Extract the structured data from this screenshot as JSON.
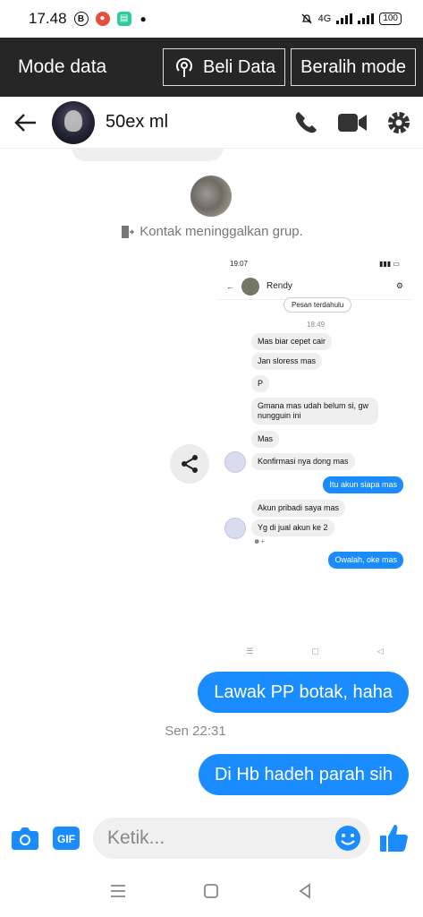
{
  "status_bar": {
    "time": "17.48",
    "network": "4G",
    "battery": "100"
  },
  "data_bar": {
    "title": "Mode data",
    "buy_label": "Beli Data",
    "switch_label": "Beralih mode"
  },
  "chat_header": {
    "name": "50ex ml"
  },
  "system_message": "Kontak meninggalkan grup.",
  "screenshot": {
    "time": "19.07",
    "name": "Rendy",
    "older_label": "Pesan terdahulu",
    "timestamp": "18:49",
    "messages": [
      {
        "text": "Mas biar cepet cair",
        "me": false
      },
      {
        "text": "Jan sloress mas",
        "me": false
      },
      {
        "text": "P",
        "me": false
      },
      {
        "text": "Gmana mas udah belum si, gw nungguin ini",
        "me": false
      },
      {
        "text": "Mas",
        "me": false
      },
      {
        "text": "Konfirmasi nya dong mas",
        "me": false
      },
      {
        "text": "Itu akun siapa mas",
        "me": true
      },
      {
        "text": "Akun pribadi saya mas",
        "me": false
      },
      {
        "text": "Yg di jual akun ke 2",
        "me": false
      },
      {
        "text": "Owalah, oke mas",
        "me": true
      }
    ]
  },
  "my_messages": [
    {
      "text": "Lawak PP botak, haha"
    },
    {
      "text": "Di Hb hadeh parah sih"
    }
  ],
  "separator_time": "Sen 22:31",
  "composer": {
    "placeholder": "Ketik..."
  },
  "colors": {
    "accent": "#1a8cff",
    "databar": "#262626"
  },
  "icons": [
    "back-icon",
    "phone-icon",
    "video-icon",
    "gear-icon",
    "camera-icon",
    "gif-icon",
    "emoji-icon",
    "like-icon",
    "share-icon"
  ]
}
